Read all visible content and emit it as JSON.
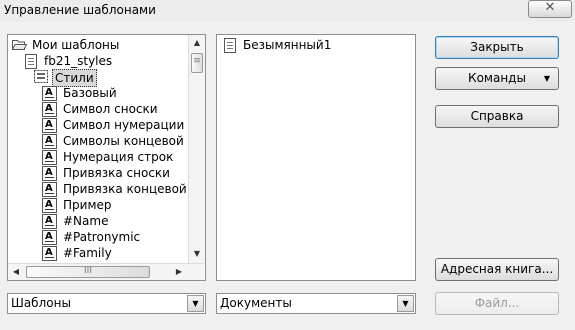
{
  "window": {
    "title": "Управление шаблонами",
    "close_glyph": "✕"
  },
  "categories": {
    "root": {
      "label": "Мои шаблоны",
      "icon": "open-folder-icon"
    },
    "document": {
      "label": "fb21_styles",
      "icon": "document-icon"
    },
    "group": {
      "label": "Стили",
      "icon": "styles-icon"
    },
    "styles": [
      "Базовый",
      "Символ сноски",
      "Символ нумерации",
      "Символы концевой сноски",
      "Нумерация строк",
      "Привязка сноски",
      "Привязка концевой сноски",
      "Пример",
      "#Name",
      "#Patronymic",
      "#Family"
    ]
  },
  "documents_list": {
    "items": [
      {
        "label": "Безымянный1",
        "icon": "document-icon"
      }
    ]
  },
  "buttons": {
    "close": "Закрыть",
    "commands": "Команды",
    "help": "Справка",
    "address_book": "Адресная книга...",
    "file": "Файл..."
  },
  "combos": {
    "left": "Шаблоны",
    "right": "Документы"
  },
  "scroll_glyphs": {
    "up": "▲",
    "down": "▼",
    "left": "◀",
    "right": "▶",
    "grip_v": "≡",
    "grip_h": "III"
  }
}
